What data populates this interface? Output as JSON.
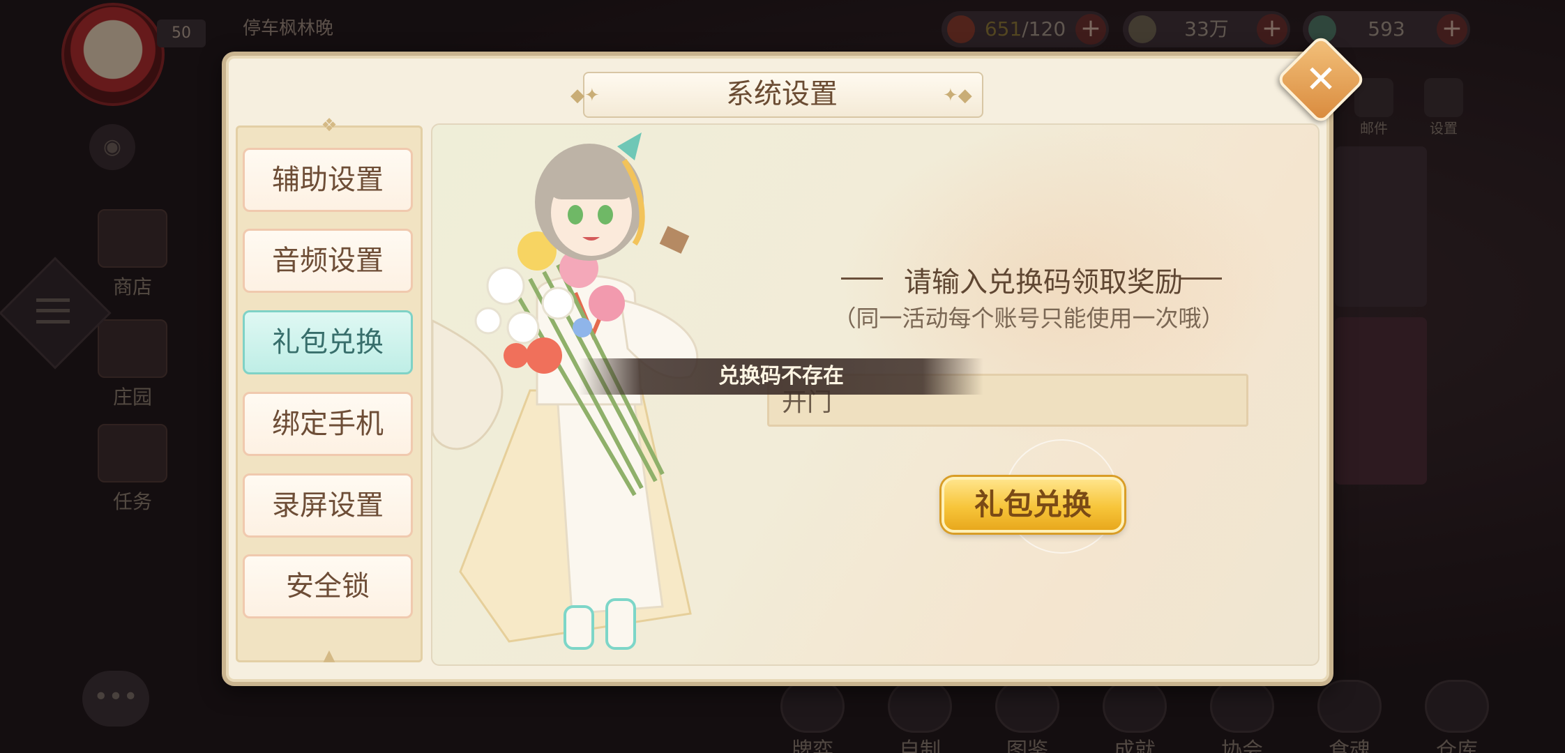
{
  "hud": {
    "player_level": "50",
    "player_name": "停车枫林晚",
    "stamina_current": "651",
    "stamina_max": "/120",
    "coins": "33万",
    "gems": "593",
    "plus": "+"
  },
  "left_side": {
    "shop": "商店",
    "manor": "庄园",
    "tasks": "任务"
  },
  "right_top": {
    "mail": "邮件",
    "settings": "设置"
  },
  "bottom_nav": [
    "牌弈",
    "自制",
    "图鉴",
    "成就",
    "协会",
    "食魂",
    "仓库"
  ],
  "dialog": {
    "title": "系统设置",
    "tabs": [
      {
        "label": "辅助设置",
        "active": false
      },
      {
        "label": "音频设置",
        "active": false
      },
      {
        "label": "礼包兑换",
        "active": true
      },
      {
        "label": "绑定手机",
        "active": false
      },
      {
        "label": "录屏设置",
        "active": false
      },
      {
        "label": "安全锁",
        "active": false
      }
    ],
    "redeem": {
      "prompt": "请输入兑换码领取奖励",
      "note": "（同一活动每个账号只能使用一次哦）",
      "input_value": "开门",
      "button_label": "礼包兑换"
    },
    "toast": "兑换码不存在"
  },
  "colors": {
    "dialog_bg": "#f6efdf",
    "active_tab": "#bfeee6",
    "button_gold": "#f7c53a",
    "title_text": "#6a4b32"
  }
}
